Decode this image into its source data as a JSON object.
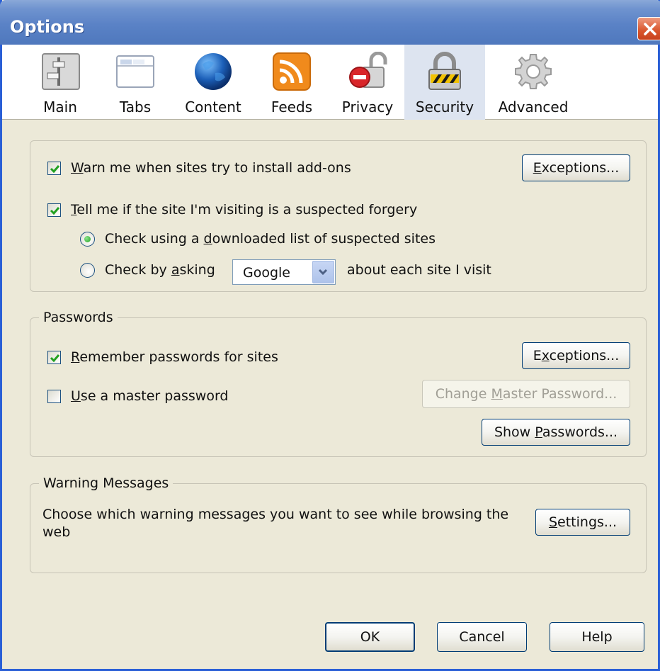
{
  "window": {
    "title": "Options"
  },
  "tabs": [
    {
      "label": "Main",
      "icon": "switch-panel-icon"
    },
    {
      "label": "Tabs",
      "icon": "browser-window-icon"
    },
    {
      "label": "Content",
      "icon": "globe-icon"
    },
    {
      "label": "Feeds",
      "icon": "rss-feed-icon"
    },
    {
      "label": "Privacy",
      "icon": "privacy-lock-icon"
    },
    {
      "label": "Security",
      "icon": "padlock-icon",
      "selected": true
    },
    {
      "label": "Advanced",
      "icon": "gear-icon"
    }
  ],
  "general": {
    "warn_addons": {
      "pre": "",
      "key": "W",
      "post": "arn me when sites try to install add-ons",
      "checked": true
    },
    "exceptions_addons": {
      "pre": "",
      "key": "E",
      "post": "xceptions..."
    },
    "forgery": {
      "pre": "",
      "key": "T",
      "post": "ell me if the site I'm visiting is a suspected forgery",
      "checked": true
    },
    "radio_list": {
      "pre": "Check using a ",
      "key": "d",
      "post": "ownloaded list of suspected sites",
      "selected": true
    },
    "radio_ask": {
      "pre": "Check by ",
      "key": "a",
      "post": "sking",
      "selected": false
    },
    "provider_select": {
      "value": "Google"
    },
    "ask_suffix": "about each site I visit"
  },
  "passwords": {
    "legend": "Passwords",
    "remember": {
      "pre": "",
      "key": "R",
      "post": "emember passwords for sites",
      "checked": true
    },
    "exceptions": {
      "pre": "E",
      "key": "x",
      "post": "ceptions..."
    },
    "master": {
      "pre": "",
      "key": "U",
      "post": "se a master password",
      "checked": false
    },
    "change_master": {
      "pre": "Change ",
      "key": "M",
      "post": "aster Password..."
    },
    "show_passwords": {
      "pre": "Show ",
      "key": "P",
      "post": "asswords..."
    }
  },
  "warnings": {
    "legend": "Warning Messages",
    "text_line1": "Choose which warning messages you want to see while browsing the",
    "text_line2": "web",
    "settings": {
      "pre": "",
      "key": "S",
      "post": "ettings..."
    }
  },
  "footer": {
    "ok": "OK",
    "cancel": "Cancel",
    "help": "Help"
  },
  "colors": {
    "titlebar": "#5a82c6",
    "selected_tab": "#dde4f0",
    "dialog_bg": "#ece9d8",
    "check_green": "#21a121"
  }
}
